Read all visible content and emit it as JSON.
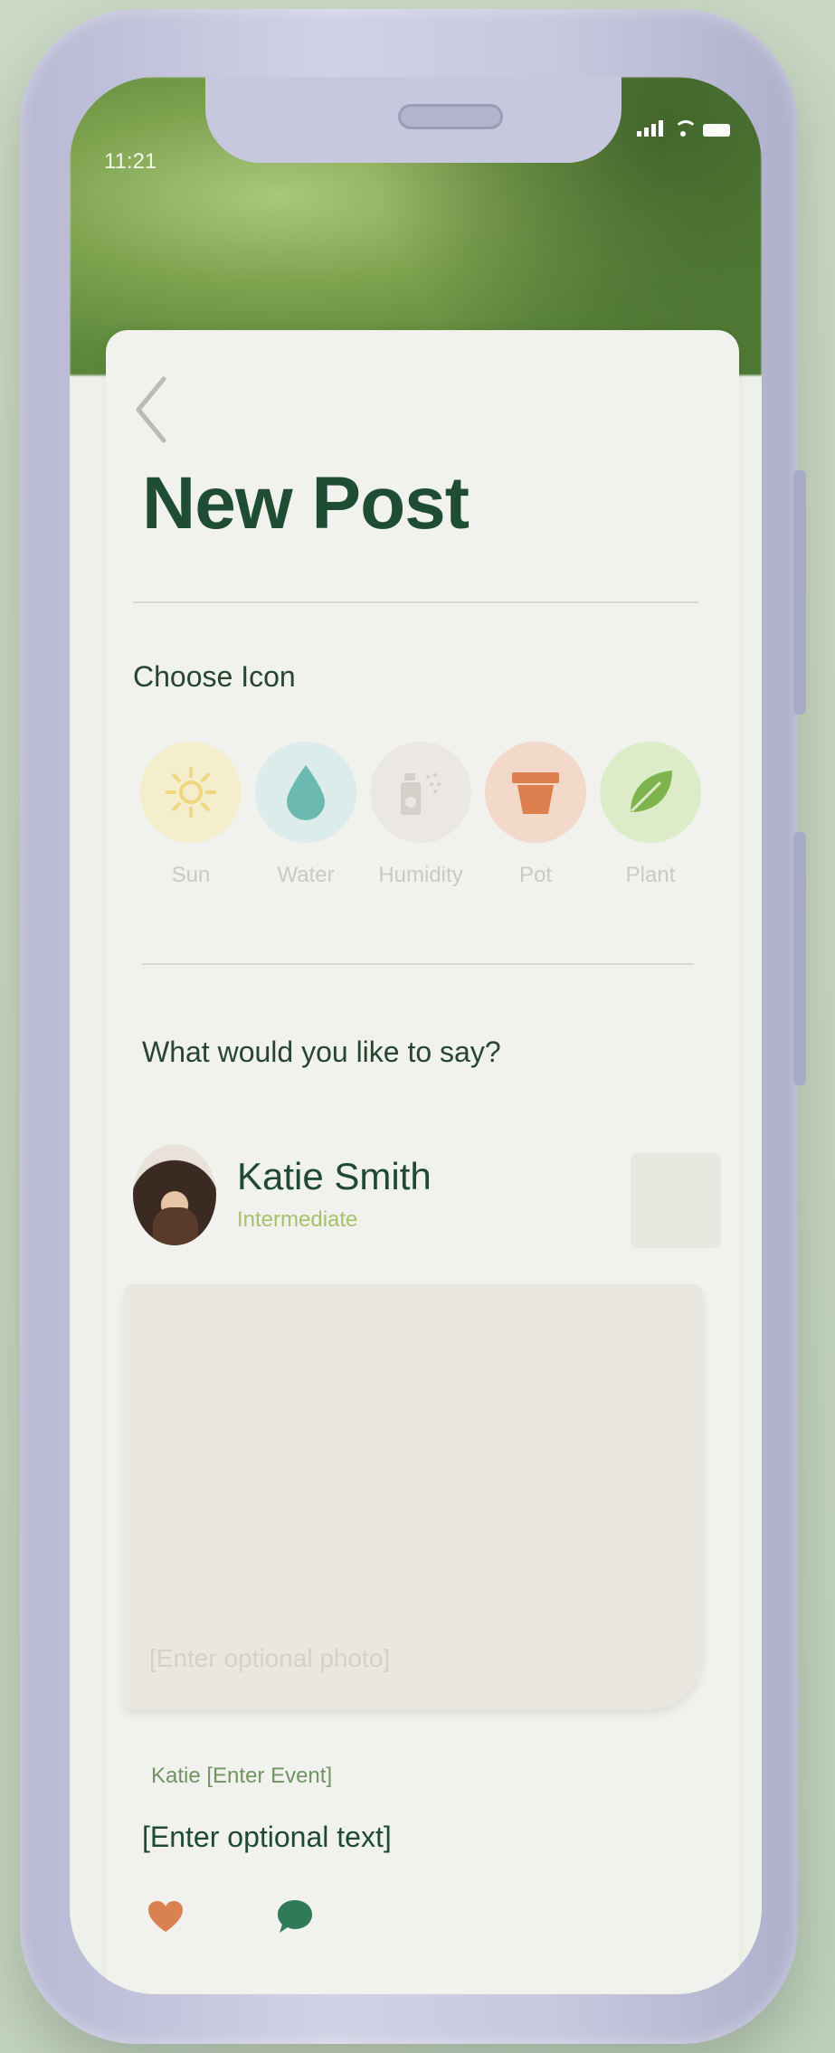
{
  "status_bar": {
    "time": "11:21"
  },
  "header": {
    "title": "New Post"
  },
  "choose_icon": {
    "label": "Choose Icon",
    "options": [
      {
        "icon": "sun-icon",
        "label": "Sun",
        "color": "#f4eecc"
      },
      {
        "icon": "water-drop-icon",
        "label": "Water",
        "color": "#dcecea"
      },
      {
        "icon": "humidifier-icon",
        "label": "Humidity",
        "color": "#ebe7e2"
      },
      {
        "icon": "pot-icon",
        "label": "Pot",
        "color": "#f3d9ca"
      },
      {
        "icon": "leaf-icon",
        "label": "Plant",
        "color": "#dcecc8"
      }
    ]
  },
  "compose": {
    "prompt": "What would you like to say?",
    "author": {
      "name": "Katie Smith",
      "level": "Intermediate"
    },
    "photo_placeholder": "[Enter optional photo]",
    "event_line": "Katie [Enter Event]",
    "text_placeholder": "[Enter optional text]"
  },
  "colors": {
    "title": "#1e4d33",
    "heart": "#d9824f",
    "comment": "#2f7a57"
  }
}
